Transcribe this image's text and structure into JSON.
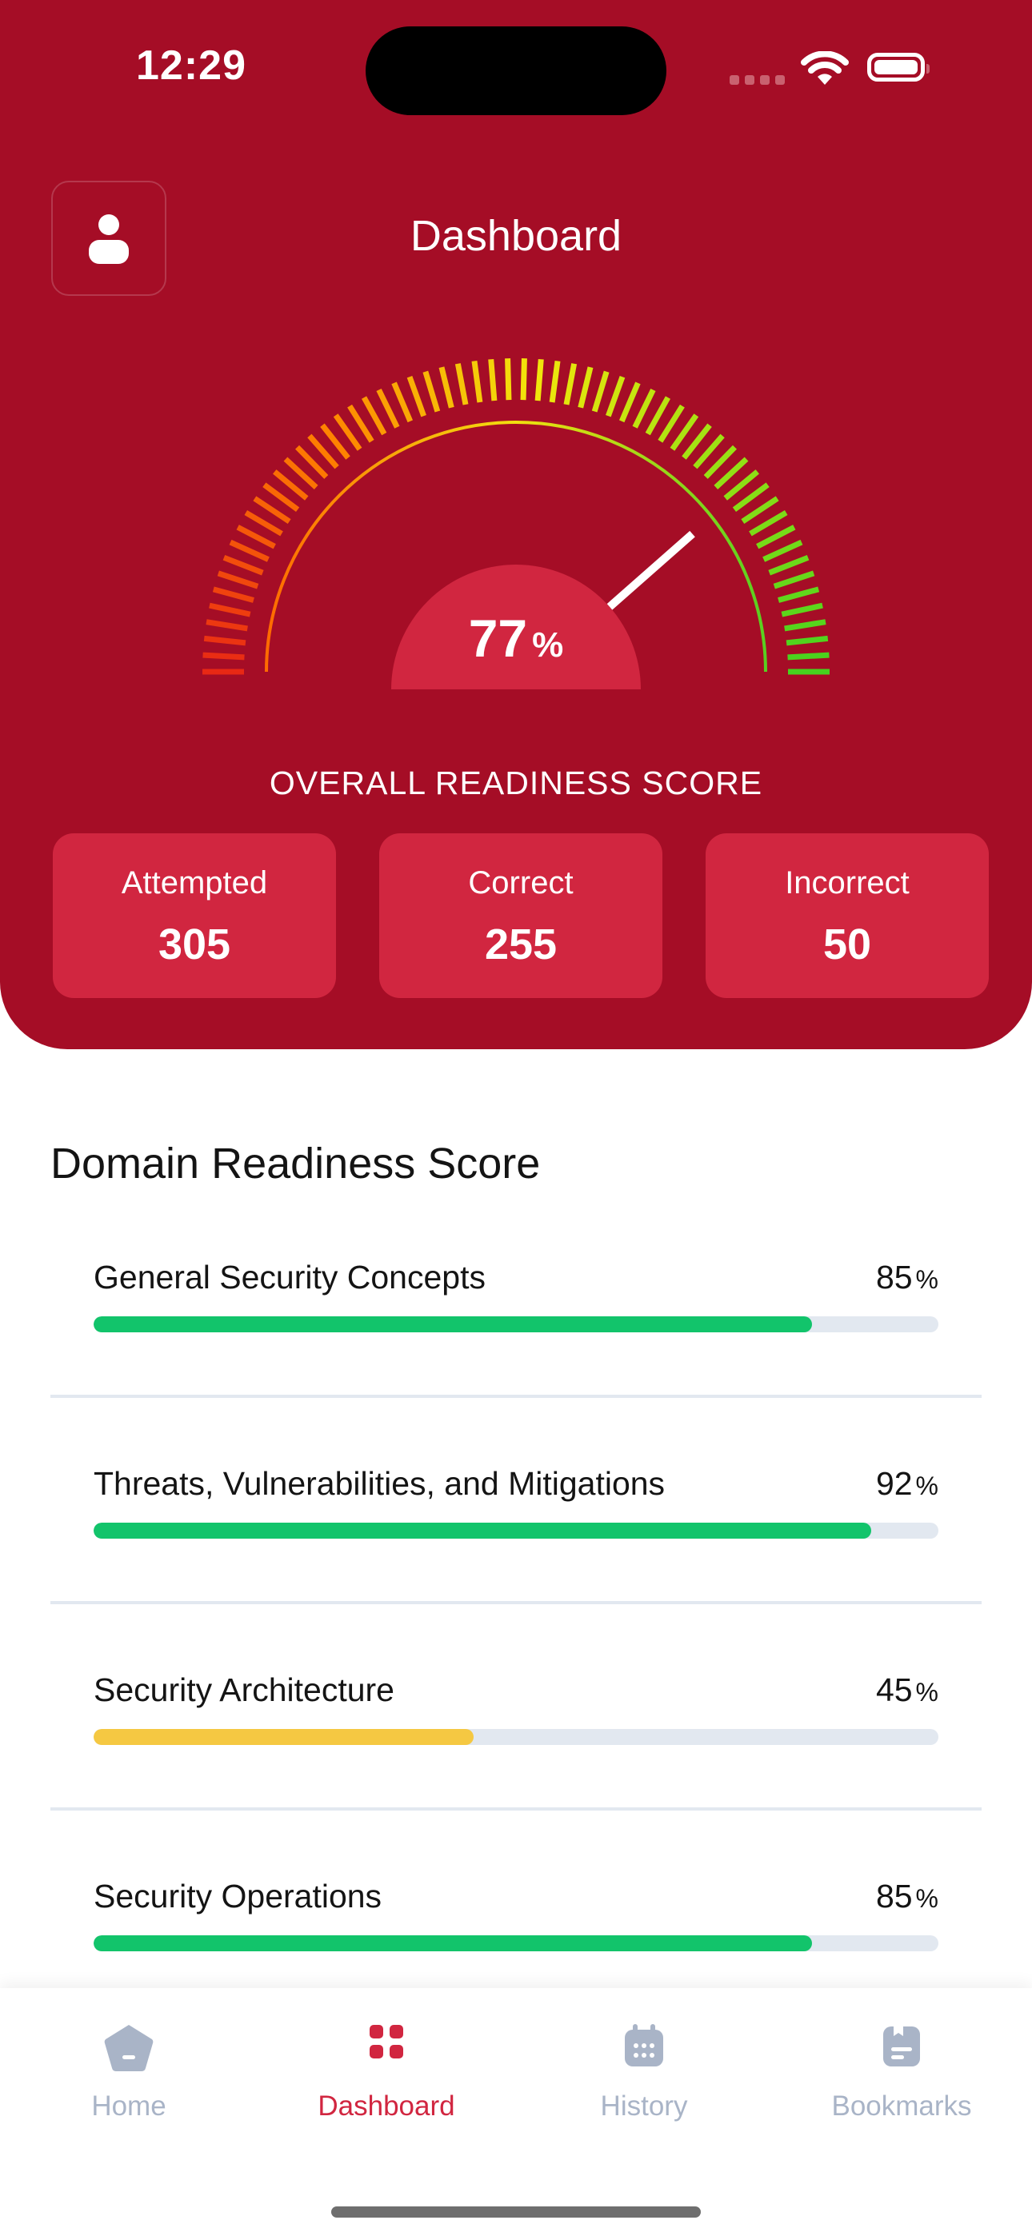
{
  "status_bar": {
    "time": "12:29"
  },
  "header": {
    "title": "Dashboard"
  },
  "gauge": {
    "score": "77",
    "percent_sign": "%",
    "label": "OVERALL READINESS SCORE",
    "needle_fraction": 0.77
  },
  "stats": [
    {
      "label": "Attempted",
      "value": "305"
    },
    {
      "label": "Correct",
      "value": "255"
    },
    {
      "label": "Incorrect",
      "value": "50"
    }
  ],
  "domains": {
    "title": "Domain Readiness Score",
    "items": [
      {
        "name": "General Security Concepts",
        "value": "85",
        "percent_sign": "%",
        "fraction": 0.85,
        "bar_color": "#12c46b"
      },
      {
        "name": "Threats, Vulnerabilities, and Mitigations",
        "value": "92",
        "percent_sign": "%",
        "fraction": 0.92,
        "bar_color": "#12c46b"
      },
      {
        "name": "Security Architecture",
        "value": "45",
        "percent_sign": "%",
        "fraction": 0.45,
        "bar_color": "#f5c842"
      },
      {
        "name": "Security Operations",
        "value": "85",
        "percent_sign": "%",
        "fraction": 0.85,
        "bar_color": "#12c46b"
      }
    ]
  },
  "tabbar": {
    "home": "Home",
    "dashboard": "Dashboard",
    "history": "History",
    "bookmarks": "Bookmarks"
  },
  "colors": {
    "brand": "#a50d26",
    "card": "#d12640",
    "active_tab": "#d12640",
    "inactive_tab": "#a9b4c7"
  }
}
